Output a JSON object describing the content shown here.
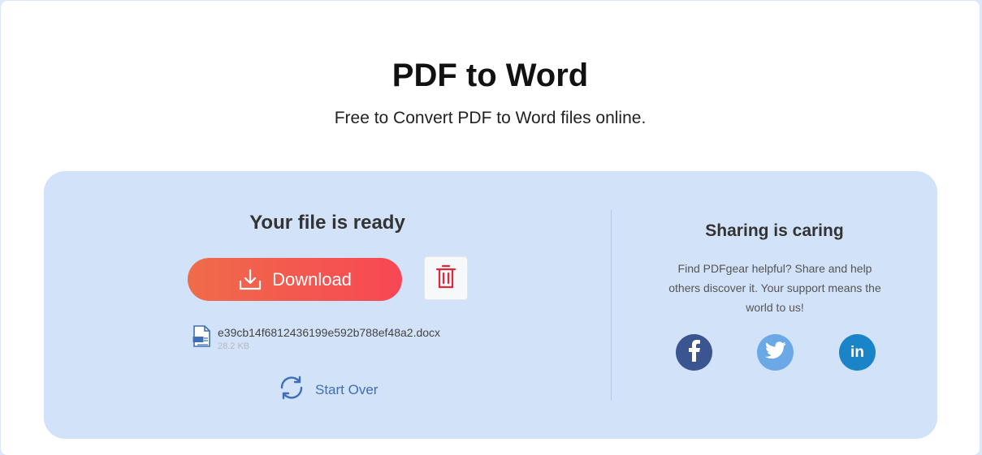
{
  "header": {
    "title": "PDF to Word",
    "subtitle": "Free to Convert PDF to Word files online."
  },
  "result": {
    "heading": "Your file is ready",
    "download_label": "Download",
    "file_name": "e39cb14f6812436199e592b788ef48a2.docx",
    "file_size": "28.2 KB",
    "start_over_label": "Start Over"
  },
  "sharing": {
    "heading": "Sharing is caring",
    "text": "Find PDFgear helpful? Share and help others discover it. Your support means the world to us!",
    "icons": [
      "facebook-icon",
      "twitter-icon",
      "linkedin-icon"
    ]
  },
  "colors": {
    "download_gradient_start": "#ef6c4a",
    "download_gradient_end": "#f74754",
    "card_bg": "#d2e2f8",
    "facebook": "#3b5591",
    "twitter": "#6ba9e6",
    "linkedin": "#1a84c8",
    "link": "#3d6fb6"
  }
}
